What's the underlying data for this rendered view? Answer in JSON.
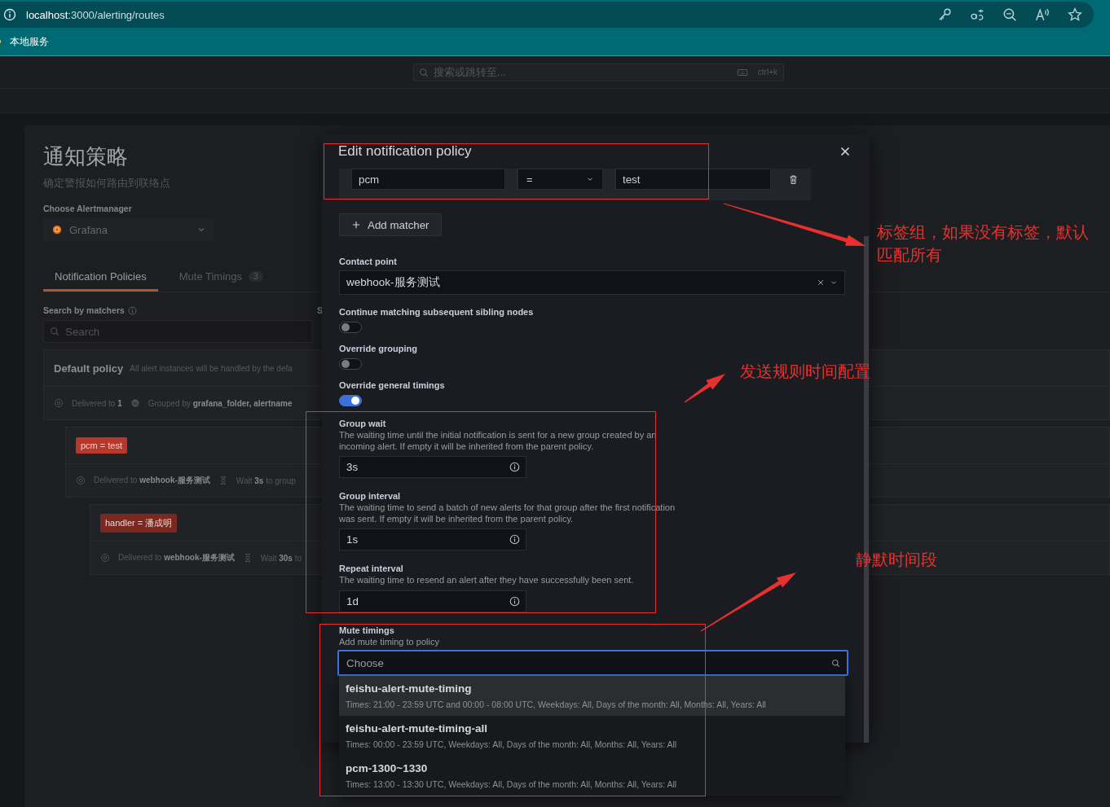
{
  "browser": {
    "url": {
      "host": "localhost",
      "path": ":3000/alerting/routes"
    },
    "bookmarks": [
      {
        "label": "本地服务"
      }
    ]
  },
  "topbar": {
    "search_placeholder": "搜索或跳转至...",
    "shortcut": "ctrl+k"
  },
  "page": {
    "title": "通知策略",
    "subtitle": "确定警报如何路由到联络点",
    "alertmanager_label": "Choose Alertmanager",
    "alertmanager": "Grafana",
    "tabs": [
      {
        "label": "Notification Policies",
        "selected": true
      },
      {
        "label": "Mute Timings",
        "count": "3",
        "selected": false
      }
    ],
    "search_label": "Search by matchers",
    "search_placeholder": "Search",
    "column_2_label": "S",
    "policy": {
      "title": "Default policy",
      "description": "All alert instances will be handled by the defa",
      "meta": [
        {
          "kind": "delivered",
          "text": "Delivered to **1**"
        },
        {
          "kind": "grouped",
          "text": "Grouped by **grafana_folder, alertname**"
        }
      ],
      "children": [
        {
          "matcher": "pcm = test",
          "color": "#b8372b",
          "meta": [
            {
              "kind": "delivered",
              "text": "Delivered to **webhook-服务测试**"
            },
            {
              "kind": "wait",
              "text": "Wait **3s** to group"
            }
          ],
          "children": [
            {
              "matcher": "handler = 潘成明",
              "color": "#7a2820",
              "meta": [
                {
                  "kind": "delivered",
                  "text": "Delivered to **webhook-服务测试**"
                },
                {
                  "kind": "wait",
                  "text": "Wait **30s** to"
                }
              ]
            }
          ]
        }
      ]
    }
  },
  "modal": {
    "title": "Edit notification policy",
    "matchers": [
      {
        "label": "pcm",
        "operator": "=",
        "value": "test"
      }
    ],
    "add_matcher": "Add matcher",
    "contact_point": {
      "label": "Contact point",
      "value": "webhook-服务测试"
    },
    "switches": [
      {
        "label": "Continue matching subsequent sibling nodes",
        "on": false
      },
      {
        "label": "Override grouping",
        "on": false
      },
      {
        "label": "Override general timings",
        "on": true
      }
    ],
    "timings": [
      {
        "label": "Group wait",
        "description": "The waiting time until the initial notification is sent for a new group created by an incoming alert. If empty it will be inherited from the parent policy.",
        "value": "3s"
      },
      {
        "label": "Group interval",
        "description": "The waiting time to send a batch of new alerts for that group after the first notification was sent. If empty it will be inherited from the parent policy.",
        "value": "1s"
      },
      {
        "label": "Repeat interval",
        "description": "The waiting time to resend an alert after they have successfully been sent.",
        "value": "1d"
      }
    ],
    "mute_timings": {
      "label": "Mute timings",
      "description": "Add mute timing to policy",
      "placeholder": "Choose",
      "options": [
        {
          "name": "feishu-alert-mute-timing",
          "details": "Times: 21:00 - 23:59 UTC and 00:00 - 08:00 UTC, Weekdays: All, Days of the month: All, Months: All, Years: All",
          "highlighted": true
        },
        {
          "name": "feishu-alert-mute-timing-all",
          "details": "Times: 00:00 - 23:59 UTC, Weekdays: All, Days of the month: All, Months: All, Years: All",
          "highlighted": false
        },
        {
          "name": "pcm-1300~1330",
          "details": "Times: 13:00 - 13:30 UTC, Weekdays: All, Days of the month: All, Months: All, Years: All",
          "highlighted": false
        }
      ]
    }
  },
  "annotations": [
    {
      "text": "标签组，如果没有标签，默认匹配所有"
    },
    {
      "text": "发送规则时间配置"
    },
    {
      "text": "静默时间段"
    }
  ]
}
